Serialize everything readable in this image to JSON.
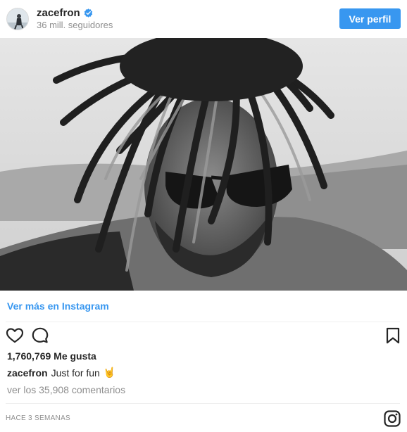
{
  "header": {
    "username": "zacefron",
    "verified_icon": "verified-badge-icon",
    "followers": "36 mill. seguidores",
    "profile_button": "Ver perfil"
  },
  "photo": {
    "alt_subject": "black-and-white portrait of a man with dreadlocks and sunglasses"
  },
  "see_more": "Ver más en Instagram",
  "actions": {
    "like_icon": "heart-icon",
    "comment_icon": "comment-icon",
    "save_icon": "bookmark-icon"
  },
  "likes": "1,760,769 Me gusta",
  "caption": {
    "user": "zacefron",
    "text": "Just for fun",
    "emoji": "🤘"
  },
  "comments_link": "ver los 35,908 comentarios",
  "timestamp": "HACE 3 SEMANAS",
  "footer": {
    "logo_icon": "instagram-logo-icon"
  },
  "colors": {
    "accent": "#3897f0",
    "text": "#262626",
    "muted": "#8e8e8e",
    "divider": "#efefef"
  }
}
